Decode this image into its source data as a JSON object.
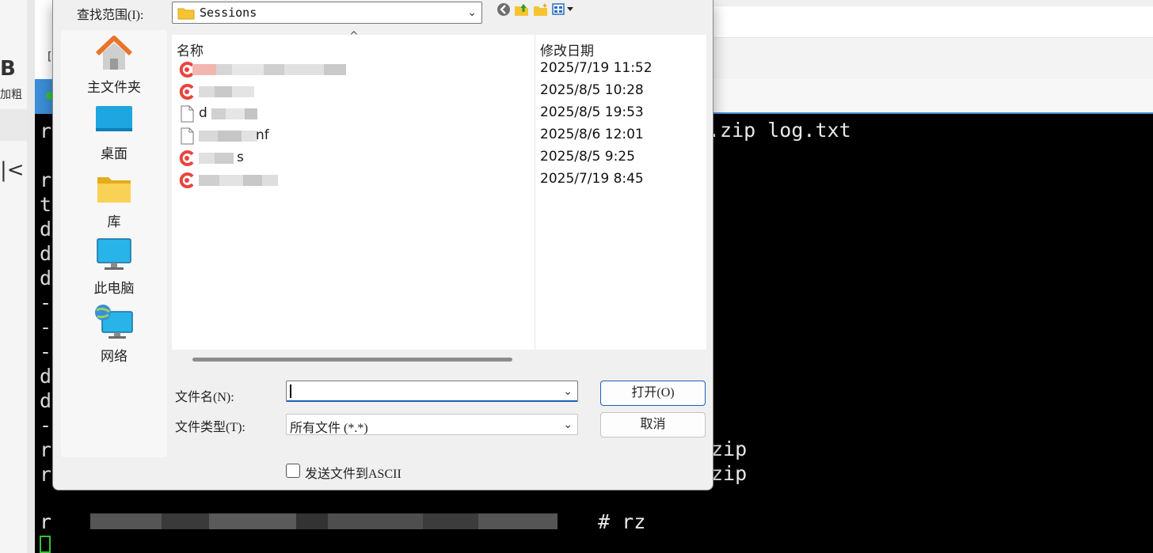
{
  "dialog": {
    "look_in_label": "查找范围(I):",
    "look_in_value": "Sessions",
    "places": [
      {
        "label": "主文件夹",
        "icon": "home-icon"
      },
      {
        "label": "桌面",
        "icon": "desktop-icon"
      },
      {
        "label": "库",
        "icon": "library-folder-icon"
      },
      {
        "label": "此电脑",
        "icon": "computer-icon"
      },
      {
        "label": "网络",
        "icon": "network-icon"
      }
    ],
    "columns": {
      "name": "名称",
      "modified": "修改日期"
    },
    "files": [
      {
        "name": "",
        "type": "session",
        "modified": "2025/7/19 11:52"
      },
      {
        "name": "",
        "type": "session",
        "modified": "2025/8/5 10:28"
      },
      {
        "name": "d",
        "type": "document",
        "modified": "2025/8/5 19:53"
      },
      {
        "name": "nf",
        "type": "document",
        "modified": "2025/8/6 12:01"
      },
      {
        "name": "s",
        "type": "session",
        "modified": "2025/8/5 9:25"
      },
      {
        "name": "",
        "type": "session",
        "modified": "2025/7/19 8:45"
      }
    ],
    "file_name_label": "文件名(N):",
    "file_name_value": "",
    "file_type_label": "文件类型(T):",
    "file_type_value": "所有文件 (*.*)",
    "open_button": "打开(O)",
    "cancel_button": "取消",
    "ascii_checkbox_label": "发送文件到ASCII",
    "ascii_checked": false
  },
  "background": {
    "left_panel_bold_letter": "B",
    "left_panel_bold_label": "加粗",
    "terminal_left_chars": "r\n\nr\nt\nd\nd\nd\n-\n-\n-\nd\nd\n-\nr\nr",
    "terminal_line1_tail": ".zip log.txt",
    "terminal_zip1_tail": "zip",
    "terminal_zip2_tail": "zip",
    "terminal_prompt_start": "r",
    "terminal_prompt_end": "# rz"
  },
  "colors": {
    "terminal_bg": "#000000",
    "terminal_fg": "#e8e8e8",
    "cursor": "#35c235",
    "accent": "#1a5fb4",
    "session_icon": "#e8453c",
    "folder": "#f5c431"
  }
}
